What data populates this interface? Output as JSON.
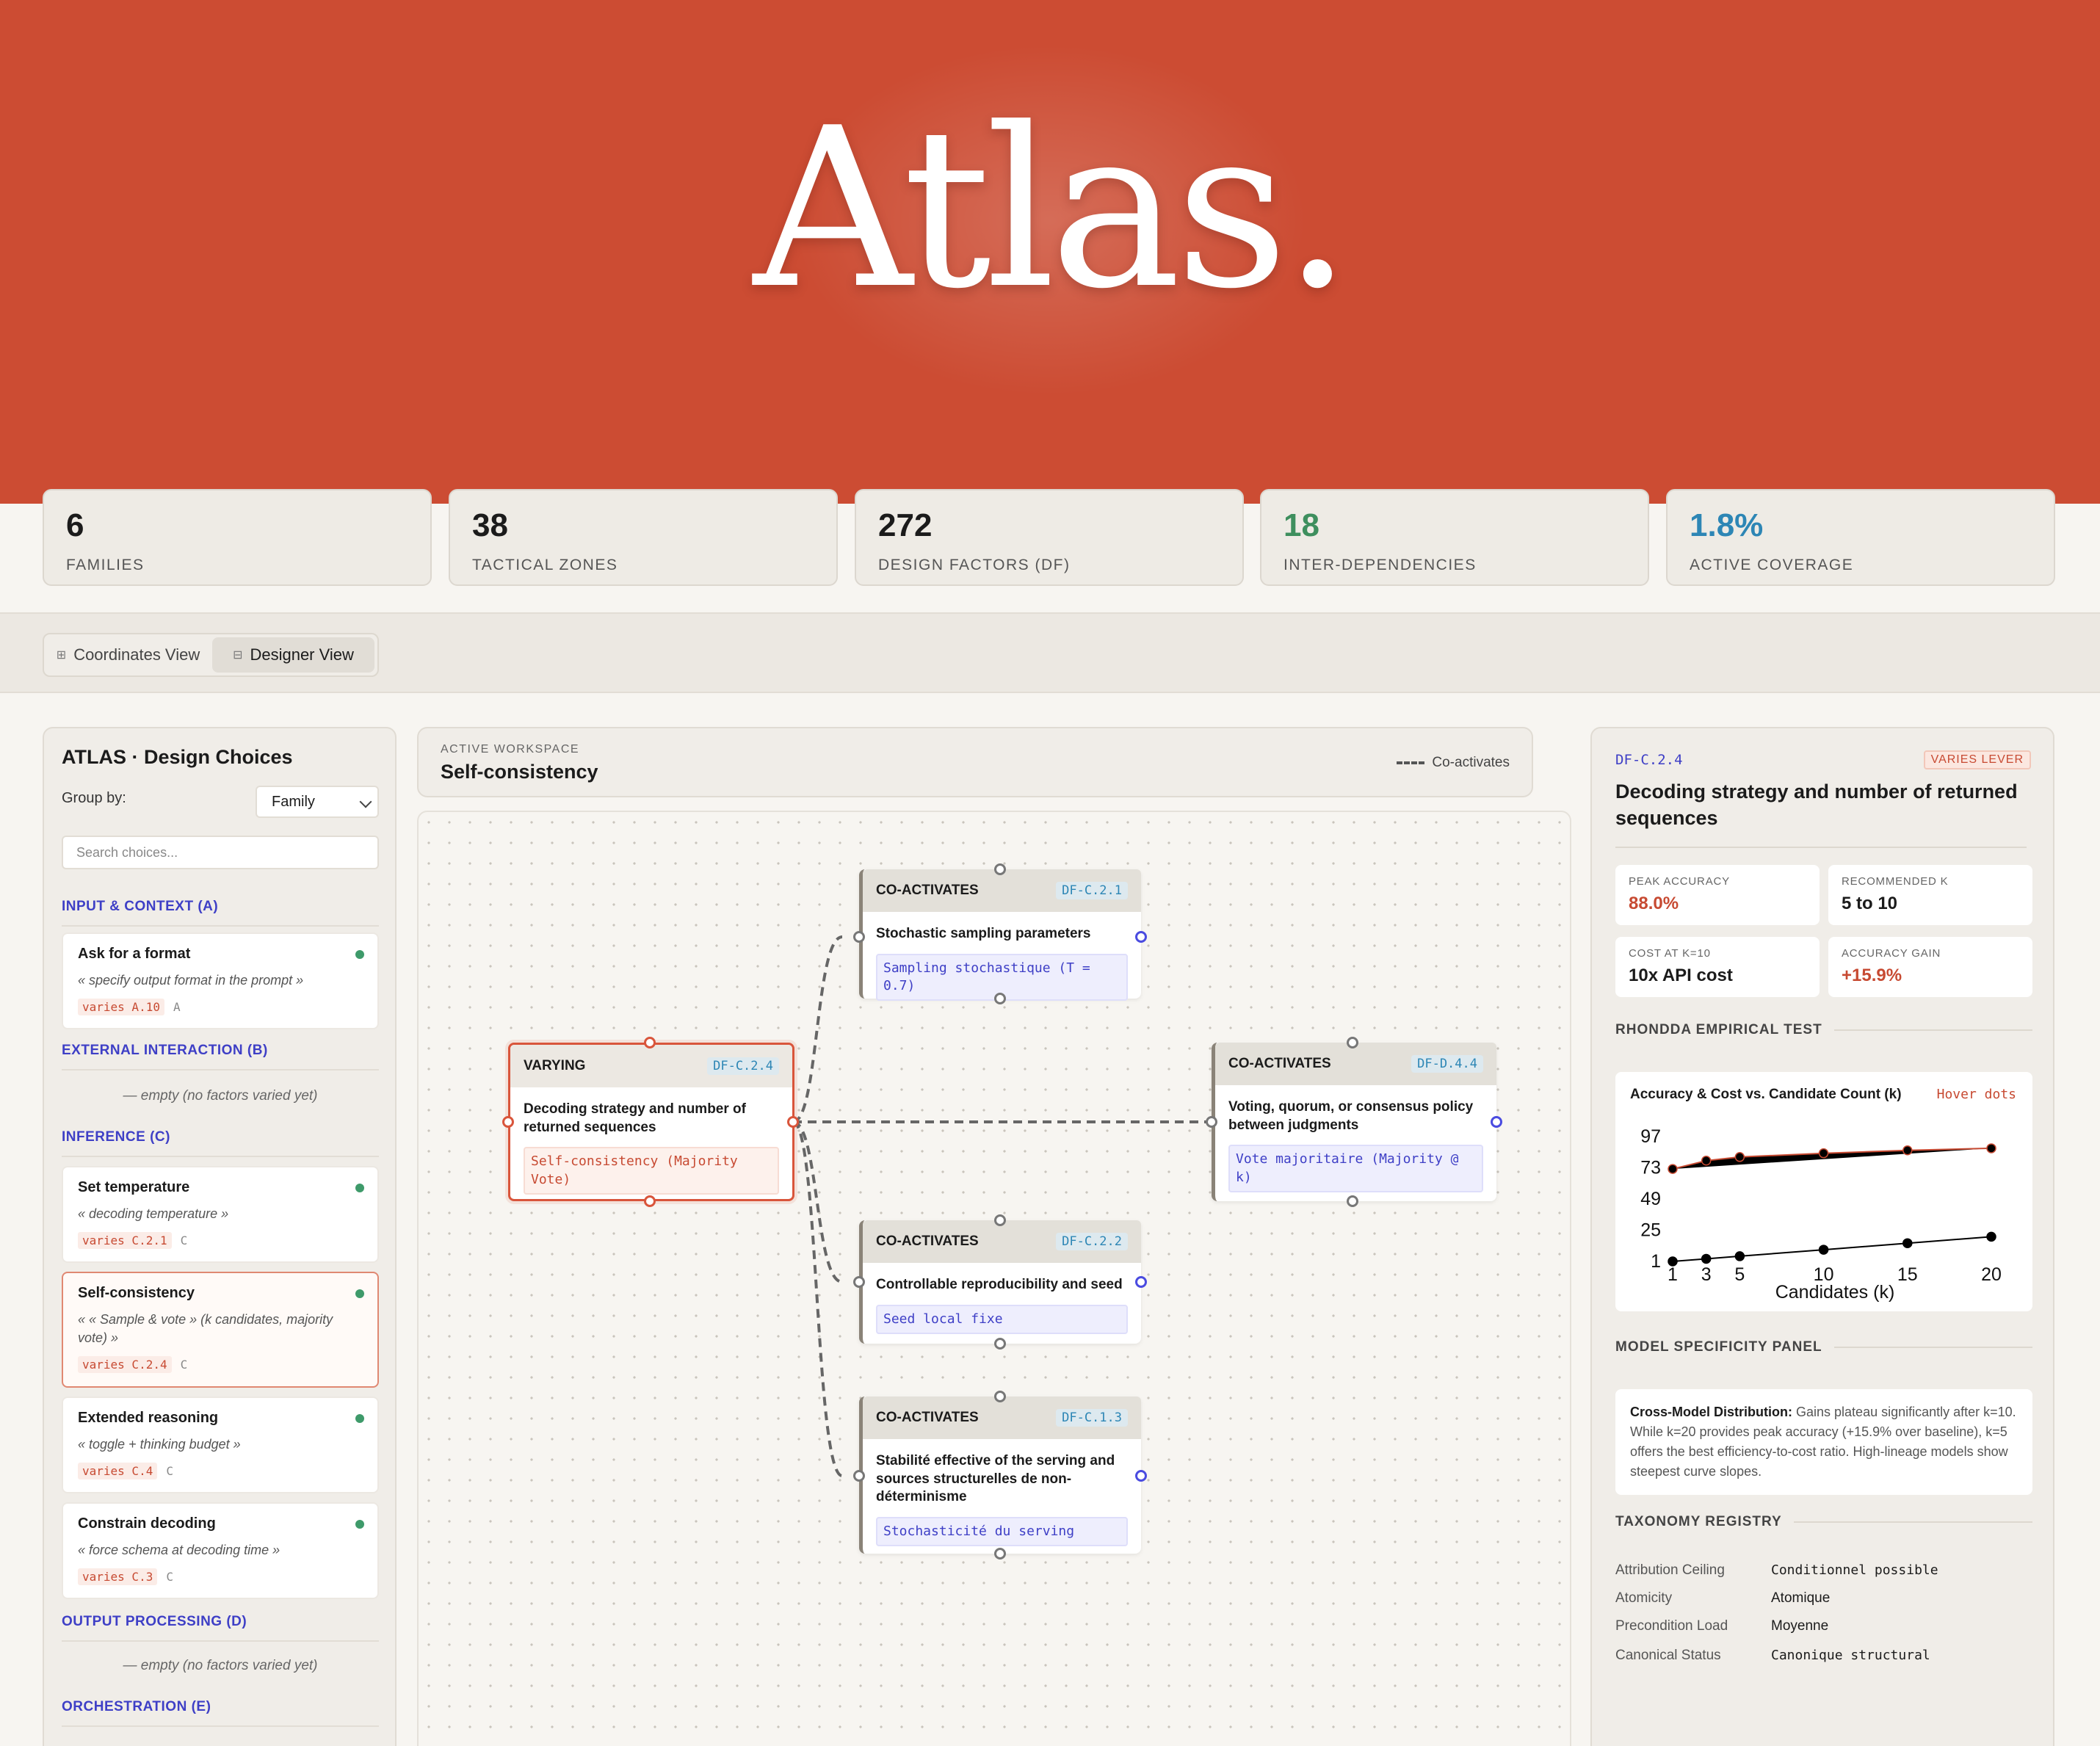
{
  "hero": {
    "title": "Atlas."
  },
  "stats": [
    {
      "value": "6",
      "label": "Families",
      "color": "#1b1b1b"
    },
    {
      "value": "38",
      "label": "Tactical Zones",
      "color": "#1b1b1b"
    },
    {
      "value": "272",
      "label": "Design Factors (DF)",
      "color": "#1b1b1b"
    },
    {
      "value": "18",
      "label": "Inter-Dependencies",
      "color": "#3e8f5e"
    },
    {
      "value": "1.8%",
      "label": "Active Coverage",
      "color": "#2d86b5"
    }
  ],
  "views": {
    "coordinates": "Coordinates View",
    "designer": "Designer View",
    "active": "designer"
  },
  "sidebar": {
    "title": "ATLAS · Design Choices",
    "group_by_label": "Group by:",
    "group_by_value": "Family",
    "search_placeholder": "Search choices...",
    "sections": {
      "input": "INPUT & CONTEXT (A)",
      "external": "EXTERNAL INTERACTION (B)",
      "inference": "INFERENCE (C)",
      "output": "OUTPUT PROCESSING (D)",
      "orchestration": "ORCHESTRATION (E)"
    },
    "empty_text": "— empty (no factors varied yet)",
    "cards": [
      {
        "title": "Ask for a format",
        "desc": "« specify output format in the prompt »",
        "tag": "varies A.10",
        "family": "A"
      },
      {
        "title": "Set temperature",
        "desc": "« decoding temperature »",
        "tag": "varies C.2.1",
        "family": "C"
      },
      {
        "title": "Self-consistency",
        "desc": "« « Sample & vote » (k candidates, majority vote) »",
        "tag": "varies C.2.4",
        "family": "C"
      },
      {
        "title": "Extended reasoning",
        "desc": "« toggle + thinking budget »",
        "tag": "varies C.4",
        "family": "C"
      },
      {
        "title": "Constrain decoding",
        "desc": "« force schema at decoding time »",
        "tag": "varies C.3",
        "family": "C"
      }
    ]
  },
  "workspace": {
    "label": "ACTIVE WORKSPACE",
    "title": "Self-consistency",
    "legend": "Co-activates"
  },
  "nodes": {
    "varying": {
      "kind": "VARYING",
      "id": "DF-C.2.4",
      "title": "Decoding strategy and number of returned sequences",
      "value": "Self-consistency (Majority Vote)"
    },
    "n1": {
      "kind": "CO-ACTIVATES",
      "id": "DF-C.2.1",
      "title": "Stochastic sampling parameters",
      "value": "Sampling stochastique (T = 0.7)"
    },
    "n2": {
      "kind": "CO-ACTIVATES",
      "id": "DF-D.4.4",
      "title": "Voting, quorum, or consensus policy between judgments",
      "value": "Vote majoritaire (Majority @ k)"
    },
    "n3": {
      "kind": "CO-ACTIVATES",
      "id": "DF-C.2.2",
      "title": "Controllable reproducibility and seed",
      "value": "Seed local fixe"
    },
    "n4": {
      "kind": "CO-ACTIVATES",
      "id": "DF-C.1.3",
      "title": "Stabilité effective of the serving and sources structurelles de non-déterminisme",
      "value": "Stochasticité du serving"
    }
  },
  "detail": {
    "id": "DF-C.2.4",
    "badge": "VARIES LEVER",
    "title": "Decoding strategy and number of returned sequences",
    "metrics": [
      {
        "label": "PEAK ACCURACY",
        "value": "88.0%",
        "accent": true
      },
      {
        "label": "RECOMMENDED K",
        "value": "5 to 10",
        "accent": false
      },
      {
        "label": "COST AT K=10",
        "value": "10x API cost",
        "accent": false
      },
      {
        "label": "ACCURACY GAIN",
        "value": "+15.9%",
        "accent": true
      }
    ],
    "empirical_heading": "RHONDDA EMPIRICAL TEST",
    "model_heading": "MODEL SPECIFICITY PANEL",
    "note_lead": "Cross-Model Distribution:",
    "note_body": "Gains plateau significantly after k=10. While k=20 provides peak accuracy (+15.9% over baseline), k=5 offers the best efficiency-to-cost ratio. High-lineage models show steepest curve slopes.",
    "registry_heading": "TAXONOMY REGISTRY",
    "registry": [
      {
        "key": "Attribution Ceiling",
        "value": "Conditionnel possible",
        "mono": true
      },
      {
        "key": "Atomicity",
        "value": "Atomique",
        "mono": false
      },
      {
        "key": "Precondition Load",
        "value": "Moyenne",
        "mono": false
      },
      {
        "key": "Canonical Status",
        "value": "Canonique structural",
        "mono": true
      }
    ]
  },
  "chart_data": {
    "type": "line",
    "title": "Accuracy & Cost vs. Candidate Count (k)",
    "hint": "Hover dots",
    "xlabel": "Candidates (k)",
    "x": [
      1,
      3,
      5,
      10,
      15,
      20
    ],
    "xticks": [
      "1",
      "3",
      "5",
      "10",
      "15",
      "20"
    ],
    "yticks": [
      "97",
      "73",
      "49",
      "25",
      "1"
    ],
    "ylim": [
      1,
      97
    ],
    "series": [
      {
        "values": [
          72.1,
          78.5,
          81.3,
          84.2,
          86.4,
          88.0
        ],
        "color": "#c74a32"
      },
      {
        "values": [
          1,
          3,
          5,
          10,
          15,
          20
        ],
        "color": "#000000"
      }
    ]
  }
}
